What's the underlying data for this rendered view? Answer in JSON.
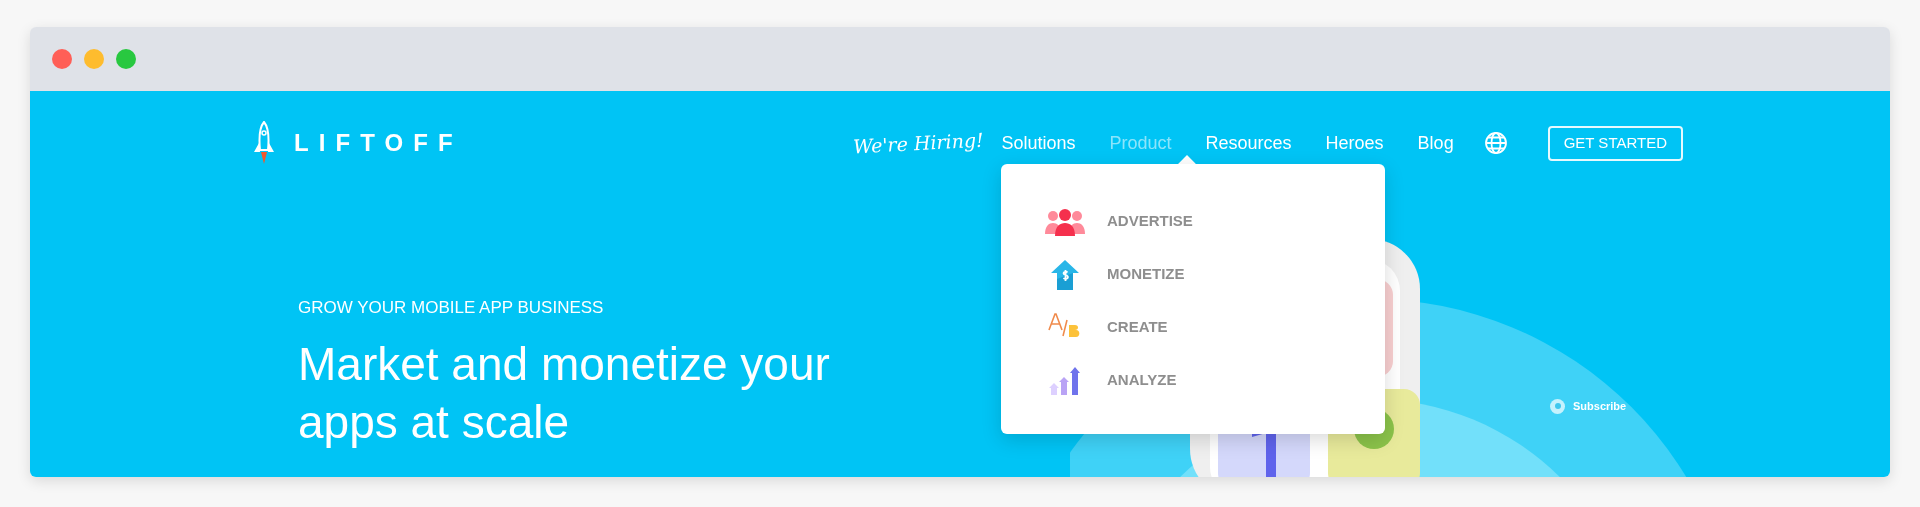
{
  "browser": {
    "controls": [
      {
        "color": "#ff5f57"
      },
      {
        "color": "#febc2e"
      },
      {
        "color": "#28c840"
      }
    ]
  },
  "header": {
    "logo": "LIFTOFF",
    "hiring": "We're Hiring!",
    "nav": [
      {
        "label": "Solutions",
        "selected": false
      },
      {
        "label": "Product",
        "selected": true
      },
      {
        "label": "Resources",
        "selected": false
      },
      {
        "label": "Heroes",
        "selected": false
      },
      {
        "label": "Blog",
        "selected": false
      }
    ],
    "cta": "GET STARTED"
  },
  "dropdown": {
    "items": [
      {
        "kind": "people",
        "label": "ADVERTISE"
      },
      {
        "kind": "money",
        "label": "MONETIZE"
      },
      {
        "kind": "ab",
        "label": "CREATE"
      },
      {
        "kind": "chart",
        "label": "ANALYZE"
      }
    ]
  },
  "hero": {
    "eyebrow": "GROW YOUR MOBILE APP BUSINESS",
    "headline": "Market and monetize your apps at scale",
    "subscribe": "Subscribe"
  }
}
